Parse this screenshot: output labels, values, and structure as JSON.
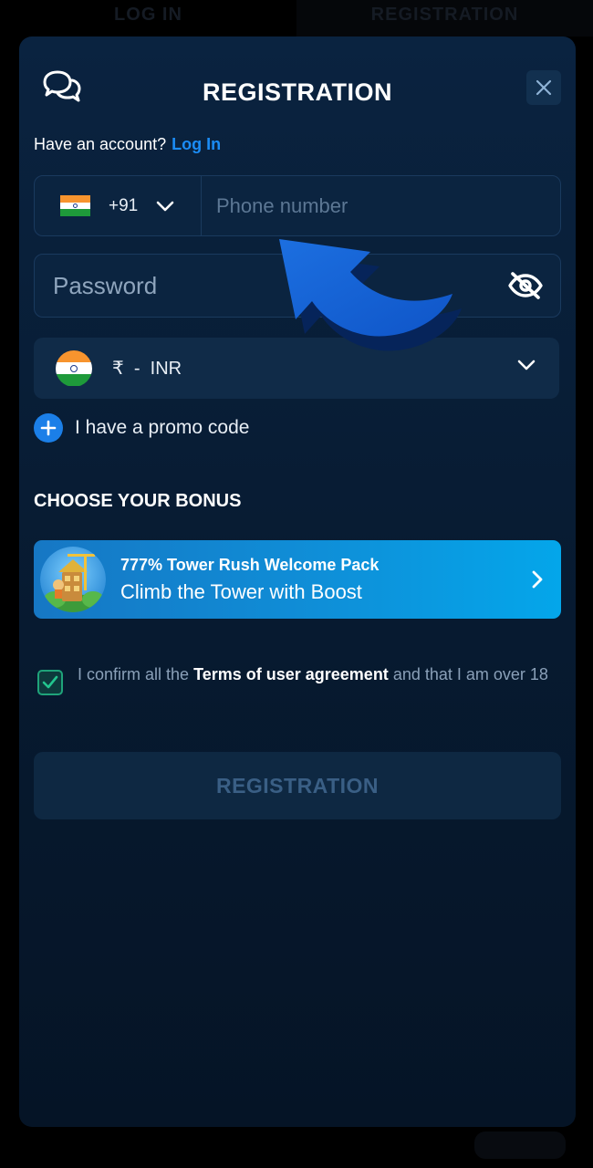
{
  "background": {
    "tabs": [
      {
        "label": "LOG IN"
      },
      {
        "label": "REGISTRATION"
      }
    ]
  },
  "modal": {
    "title": "REGISTRATION",
    "account_question": "Have an account?",
    "login_link": "Log In",
    "phone": {
      "country_code": "+91",
      "placeholder": "Phone number"
    },
    "password": {
      "placeholder": "Password"
    },
    "currency": {
      "symbol": "₹",
      "separator": "-",
      "code": "INR"
    },
    "promo_label": "I have a promo code",
    "bonus_heading": "CHOOSE YOUR BONUS",
    "bonus": {
      "title": "777% Tower Rush Welcome Pack",
      "subtitle": "Climb the Tower with Boost"
    },
    "terms": {
      "prefix": "I confirm all the",
      "bold": "Terms of user agreement",
      "suffix": "and that I am over 18",
      "checked": true
    },
    "register_button": "REGISTRATION"
  },
  "colors": {
    "accent": "#1b8cf5",
    "modal_bg": "#0a2340",
    "checkbox_green": "#1fa37a",
    "bonus_gradient_end": "#04a6ea"
  },
  "icons": [
    "chat-icon",
    "close-icon",
    "chevron-down-icon",
    "eye-off-icon",
    "plus-icon",
    "chevron-right-icon",
    "check-icon",
    "pointer-arrow"
  ]
}
